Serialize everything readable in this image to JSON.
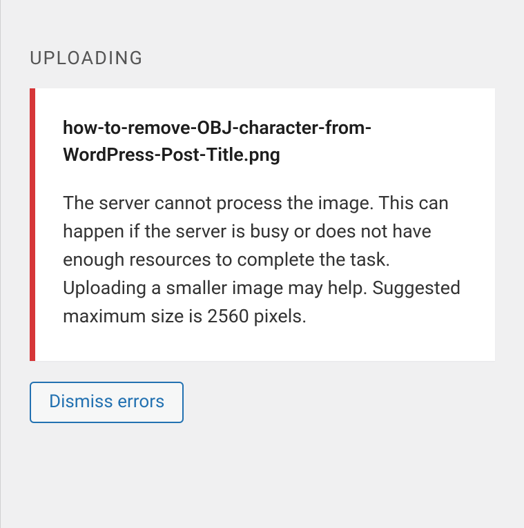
{
  "upload": {
    "heading": "UPLOADING",
    "error": {
      "filename": "how-to-remove-OBJ-character-from-WordPress-Post-Title.png",
      "message": "The server cannot process the image. This can happen if the server is busy or does not have enough resources to complete the task. Uploading a smaller image may help. Suggested maximum size is 2560 pixels."
    },
    "dismiss_label": "Dismiss errors"
  },
  "colors": {
    "error_accent": "#d63638",
    "link": "#2271b1",
    "background": "#f0f0f1"
  }
}
